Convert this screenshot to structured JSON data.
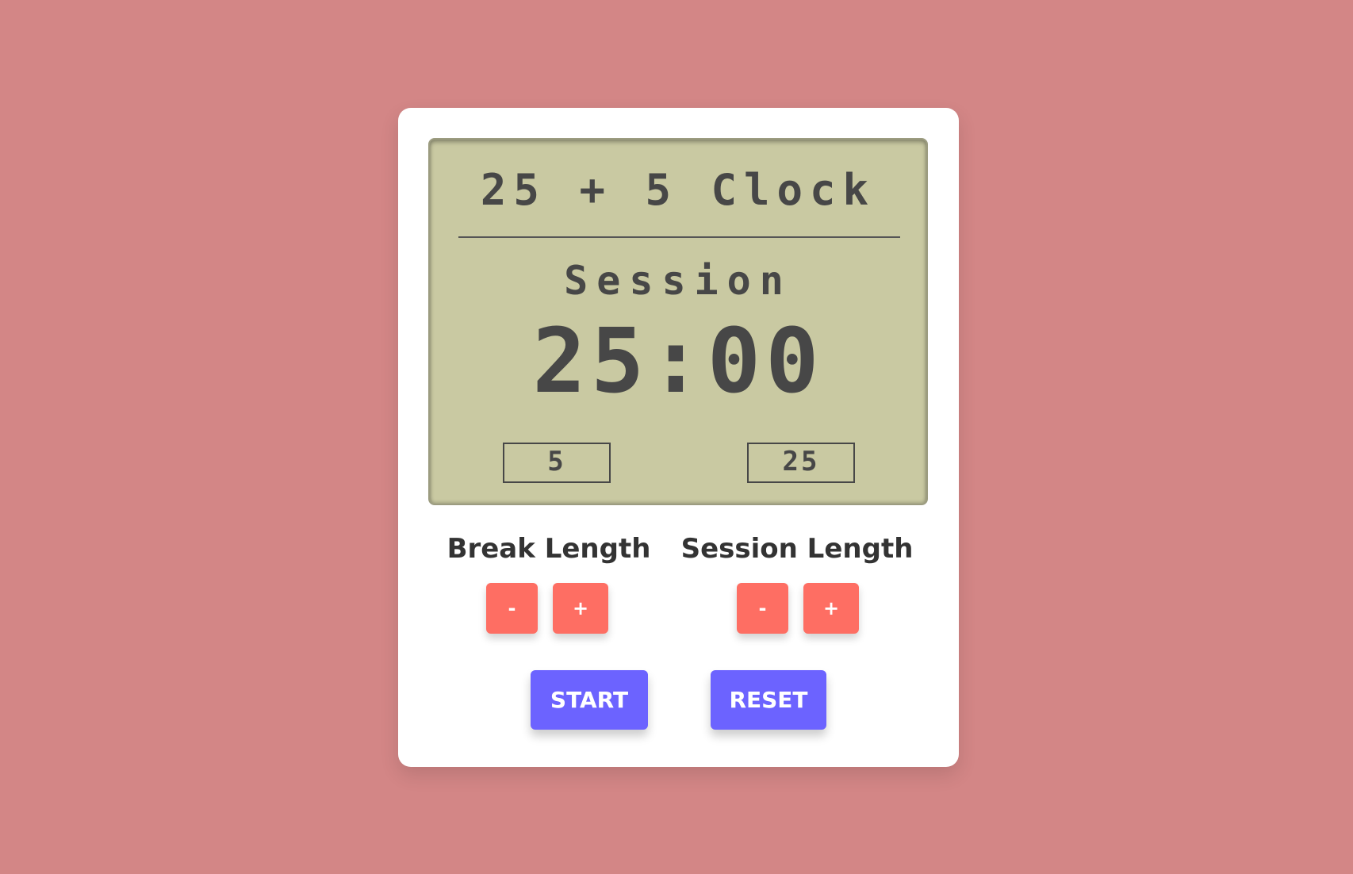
{
  "colors": {
    "background": "#d38686",
    "card": "#ffffff",
    "lcd_screen": "#c9c9a2",
    "lcd_text": "#474747",
    "adjust_button": "#fe6e63",
    "action_button": "#6c63ff"
  },
  "display": {
    "title": "25 + 5 Clock",
    "timer_label": "Session",
    "time_left": "25:00",
    "break_value": "5",
    "session_value": "25"
  },
  "controls": {
    "break_label": "Break Length",
    "session_label": "Session Length",
    "break_decrement": "-",
    "break_increment": "+",
    "session_decrement": "-",
    "session_increment": "+"
  },
  "actions": {
    "start_label": "START",
    "reset_label": "RESET"
  }
}
